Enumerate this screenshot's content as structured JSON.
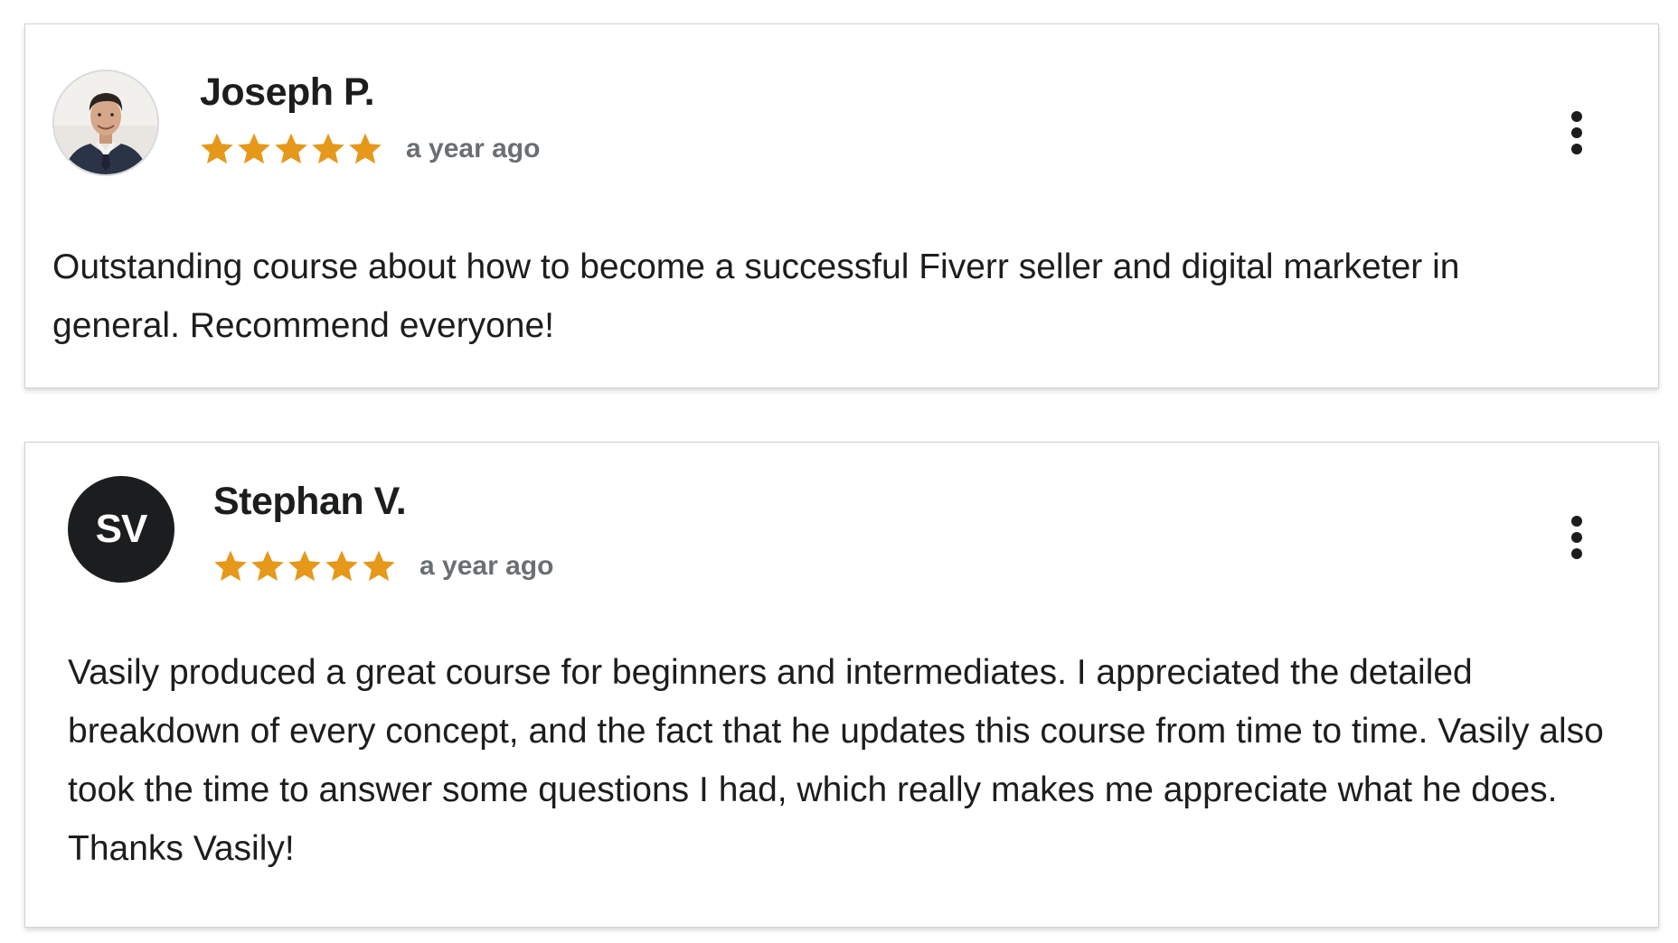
{
  "colors": {
    "star": "#e59819",
    "text": "#1c1d1f",
    "muted": "#6a6f73",
    "avatar_bg": "#1c1d1f",
    "border": "#cfd1d5"
  },
  "icons": {
    "star": "star-icon",
    "menu": "more-vertical-icon"
  },
  "reviews": [
    {
      "name": "Joseph P.",
      "avatar_type": "photo",
      "rating": 5,
      "time": "a year ago",
      "content": "Outstanding course about how to become a successful Fiverr seller and digital marketer in general. Recommend everyone!"
    },
    {
      "name": "Stephan V.",
      "avatar_type": "initials",
      "initials": "SV",
      "rating": 5,
      "time": "a year ago",
      "content": "Vasily produced a great course for beginners and intermediates. I appreciated the detailed breakdown of every concept, and the fact that he updates this course from time to time. Vasily also took the time to answer some questions I had, which really makes me appreciate what he does. Thanks Vasily!"
    }
  ]
}
